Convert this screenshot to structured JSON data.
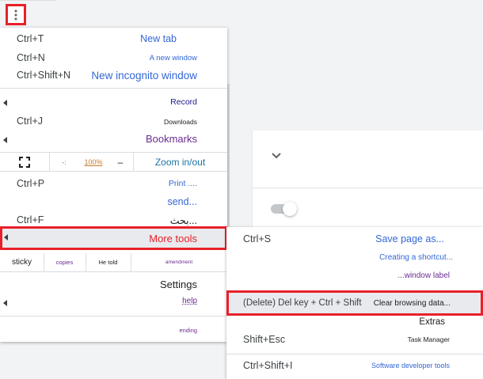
{
  "menu": {
    "items": [
      {
        "shortcut": "Ctrl+T",
        "label": "New tab"
      },
      {
        "shortcut": "Ctrl+N",
        "label": "A new window"
      },
      {
        "shortcut": "Ctrl+Shift+N",
        "label": "New incognito window"
      },
      {
        "shortcut": "",
        "label": "Record"
      },
      {
        "shortcut": "Ctrl+J",
        "label": "Downloads"
      },
      {
        "shortcut": "",
        "label": "Bookmarks"
      }
    ],
    "zoom": {
      "minus": "-:",
      "level": "100%",
      "plus": "–",
      "label": "Zoom in/out"
    },
    "print": {
      "shortcut": "Ctrl+P",
      "label": "Print ...."
    },
    "send": {
      "label": "send..."
    },
    "find": {
      "shortcut": "Ctrl+F",
      "label": "بحث..."
    },
    "more_tools": {
      "label": "More tools"
    },
    "edit": {
      "cut": "sticky",
      "copy": "copies",
      "paste": "He told",
      "label": "amendment"
    },
    "settings": {
      "label": "Settings"
    },
    "help": {
      "label": "help"
    },
    "exit": {
      "label": "ending"
    }
  },
  "submenu": {
    "items": [
      {
        "shortcut": "Ctrl+S",
        "label": "Save page as..."
      },
      {
        "shortcut": "",
        "label": "Creating a shortcut..."
      },
      {
        "shortcut": "",
        "label": "...window label"
      },
      {
        "shortcut": "(Delete) Del key + Ctrl + Shift",
        "label": "Clear browsing data..."
      },
      {
        "shortcut": "",
        "label": "Extras"
      },
      {
        "shortcut": "Shift+Esc",
        "label": "Task Manager"
      },
      {
        "shortcut": "Ctrl+Shift+I",
        "label": "Software developer tools"
      }
    ]
  },
  "colors": {
    "highlight_border": "#e8202a",
    "link_blue": "#3367d6",
    "purple": "#6a2c91",
    "orange": "#c77a2b"
  },
  "icons": {
    "menu": "vertical-dots-icon",
    "fullscreen": "fullscreen-icon",
    "submenu_arrow": "left-triangle-icon",
    "chevron": "chevron-down-icon"
  }
}
